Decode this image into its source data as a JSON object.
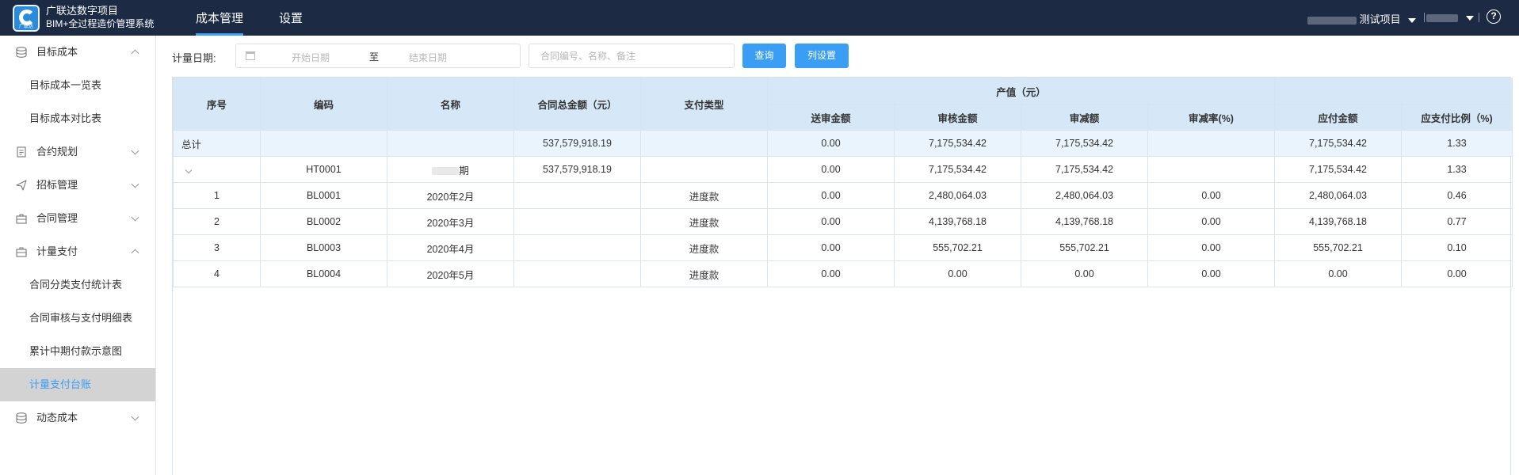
{
  "header": {
    "logo_text": "广联达",
    "app_title": "广联达数字项目",
    "app_subtitle": "BIM+全过程造价管理系统",
    "tabs": [
      {
        "label": "成本管理",
        "active": true
      },
      {
        "label": "设置",
        "active": false
      }
    ],
    "project_label": "测试项目",
    "help_glyph": "?"
  },
  "sidebar": {
    "items": [
      {
        "type": "group",
        "label": "目标成本",
        "icon": "database-icon",
        "expanded": true
      },
      {
        "type": "sub",
        "label": "目标成本一览表"
      },
      {
        "type": "sub",
        "label": "目标成本对比表"
      },
      {
        "type": "group",
        "label": "合约规划",
        "icon": "document-icon",
        "expanded": false
      },
      {
        "type": "group",
        "label": "招标管理",
        "icon": "send-icon",
        "expanded": false
      },
      {
        "type": "group",
        "label": "合同管理",
        "icon": "briefcase-icon",
        "expanded": false
      },
      {
        "type": "group",
        "label": "计量支付",
        "icon": "briefcase-icon",
        "expanded": true
      },
      {
        "type": "sub",
        "label": "合同分类支付统计表"
      },
      {
        "type": "sub",
        "label": "合同审核与支付明细表"
      },
      {
        "type": "sub",
        "label": "累计中期付款示意图"
      },
      {
        "type": "sub",
        "label": "计量支付台账",
        "active": true
      },
      {
        "type": "group",
        "label": "动态成本",
        "icon": "database-icon",
        "expanded": false
      }
    ]
  },
  "filter": {
    "date_label": "计量日期:",
    "start_placeholder": "开始日期",
    "range_sep": "至",
    "end_placeholder": "结束日期",
    "search_placeholder": "合同编号、名称、备注",
    "query_button": "查询",
    "columns_button": "列设置"
  },
  "table": {
    "headers": {
      "seq": "序号",
      "code": "编码",
      "name": "名称",
      "contract_total": "合同总金额（元）",
      "pay_type": "支付类型",
      "output_group": "产值（元）",
      "submitted": "送审金额",
      "approved": "审核金额",
      "reduction": "审减额",
      "reduction_rate": "审减率(%)",
      "payable": "应付金额",
      "pay_ratio": "应支付比例（%)"
    },
    "rows": [
      {
        "kind": "total",
        "seq": "总计",
        "code": "",
        "name": "",
        "contract_total": "537,579,918.19",
        "pay_type": "",
        "submitted": "0.00",
        "approved": "7,175,534.42",
        "reduction": "7,175,534.42",
        "reduction_rate": "",
        "payable": "7,175,534.42",
        "pay_ratio": "1.33"
      },
      {
        "kind": "parent",
        "seq": "",
        "code": "HT0001",
        "name": "期",
        "contract_total": "537,579,918.19",
        "pay_type": "",
        "submitted": "0.00",
        "approved": "7,175,534.42",
        "reduction": "7,175,534.42",
        "reduction_rate": "",
        "payable": "7,175,534.42",
        "pay_ratio": "1.33"
      },
      {
        "kind": "child",
        "seq": "1",
        "code": "BL0001",
        "name": "2020年2月",
        "contract_total": "",
        "pay_type": "进度款",
        "submitted": "0.00",
        "approved": "2,480,064.03",
        "reduction": "2,480,064.03",
        "reduction_rate": "0.00",
        "payable": "2,480,064.03",
        "pay_ratio": "0.46"
      },
      {
        "kind": "child",
        "seq": "2",
        "code": "BL0002",
        "name": "2020年3月",
        "contract_total": "",
        "pay_type": "进度款",
        "submitted": "0.00",
        "approved": "4,139,768.18",
        "reduction": "4,139,768.18",
        "reduction_rate": "0.00",
        "payable": "4,139,768.18",
        "pay_ratio": "0.77"
      },
      {
        "kind": "child",
        "seq": "3",
        "code": "BL0003",
        "name": "2020年4月",
        "contract_total": "",
        "pay_type": "进度款",
        "submitted": "0.00",
        "approved": "555,702.21",
        "reduction": "555,702.21",
        "reduction_rate": "0.00",
        "payable": "555,702.21",
        "pay_ratio": "0.10"
      },
      {
        "kind": "child",
        "seq": "4",
        "code": "BL0004",
        "name": "2020年5月",
        "contract_total": "",
        "pay_type": "进度款",
        "submitted": "0.00",
        "approved": "0.00",
        "reduction": "0.00",
        "reduction_rate": "0.00",
        "payable": "0.00",
        "pay_ratio": "0.00"
      }
    ]
  },
  "colors": {
    "topbar": "#1d2a44",
    "accent": "#3a9ef5",
    "header_fill": "#d6e8f7",
    "total_fill": "#e9f4fc"
  }
}
